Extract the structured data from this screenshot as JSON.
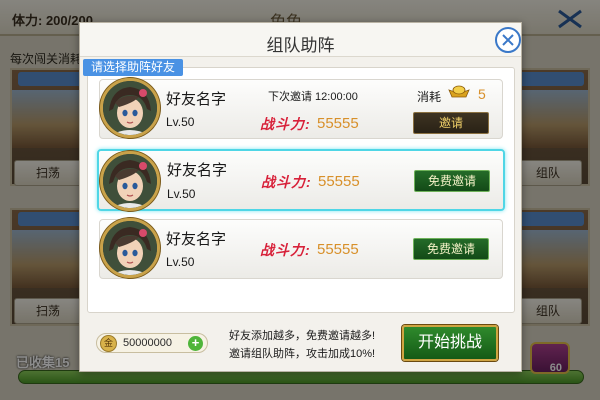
{
  "background": {
    "stamina_text": "体力: 200/200",
    "title": "免免",
    "hint": "每次闯关消耗",
    "sweep_label": "扫荡",
    "team_label": "组队",
    "collected_text": "已收集15",
    "chest_count": "60"
  },
  "dialog": {
    "title": "组队助阵",
    "list_label": "请选择助阵好友",
    "friends": [
      {
        "name": "好友名字",
        "level": "Lv.50",
        "power_label": "战斗力:",
        "power_value": "55555",
        "next_invite": "下次邀请 12:00:00",
        "cost_label": "消耗",
        "cost_value": "5",
        "button": "邀请",
        "button_style": "gold",
        "selected": false
      },
      {
        "name": "好友名字",
        "level": "Lv.50",
        "power_label": "战斗力:",
        "power_value": "55555",
        "button": "免费邀请",
        "button_style": "green",
        "selected": true
      },
      {
        "name": "好友名字",
        "level": "Lv.50",
        "power_label": "战斗力:",
        "power_value": "55555",
        "button": "免费邀请",
        "button_style": "green",
        "selected": false
      }
    ],
    "footer": {
      "coin_icon_text": "金",
      "coin_value": "50000000",
      "coin_plus": "+",
      "tip_line1": "好友添加越多，免费邀请越多!",
      "tip_line2": "邀请组队助阵，攻击加成10%!",
      "start_button": "开始挑战"
    }
  },
  "colors": {
    "accent_blue": "#4a92e4",
    "selected_border": "#4fd6e6",
    "power_red": "#d7223a",
    "value_gold": "#d8902a",
    "button_green": "#246b28"
  }
}
